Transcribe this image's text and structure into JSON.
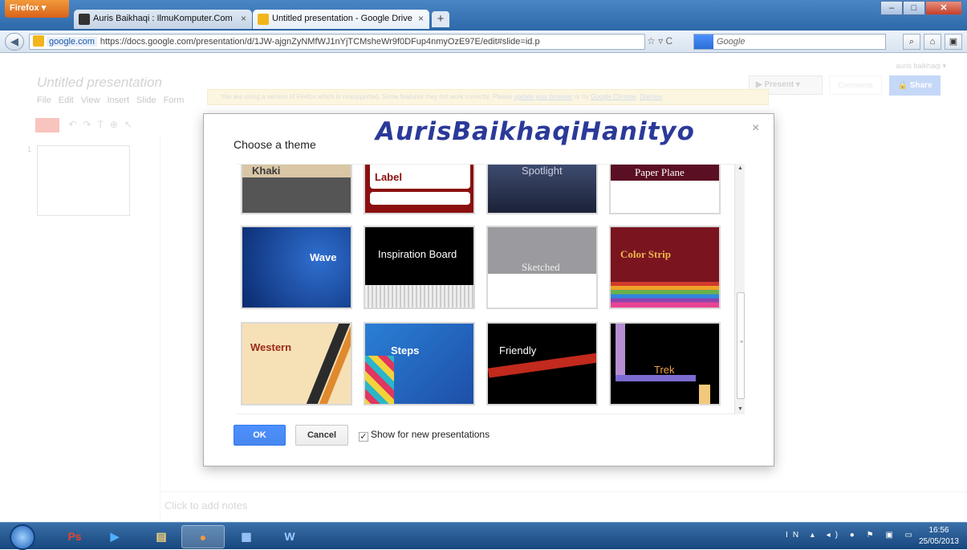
{
  "browser": {
    "menu_button": "Firefox",
    "tabs": [
      {
        "label": "Auris Baikhaqi : IlmuKomputer.Com",
        "close": "×"
      },
      {
        "label": "Untitled presentation - Google Drive",
        "close": "×"
      }
    ],
    "new_tab": "+",
    "url_domain": "google.com",
    "url": "https://docs.google.com/presentation/d/1JW-ajgnZyNMfWJ1nYjTCMsheWr9f0DFup4nmyOzE97E/edit#slide=id.p",
    "search_placeholder": "Google"
  },
  "slides": {
    "doc_title": "Untitled presentation",
    "menu": "File Edit View Insert Slide Form",
    "user": "auris baikhaqi ▾",
    "present_label": "Present",
    "comments_label": "Comments",
    "share_label": "Share",
    "warning_text": "You are using a version of Firefox which is unsupported. Some features may not work correctly. Please",
    "warning_link_update": "update your browser",
    "warning_or": "or try",
    "warning_link_chrome": "Google Chrome",
    "warning_dismiss": "Dismiss",
    "slide_number": "1",
    "notes_placeholder": "Click to add notes"
  },
  "dialog": {
    "title": "Choose a theme",
    "watermark": "AurisBaikhaqiHanityo",
    "close": "×",
    "themes": [
      {
        "name": "Khaki"
      },
      {
        "name": "Label"
      },
      {
        "name": "Spotlight"
      },
      {
        "name": "Paper Plane"
      },
      {
        "name": "Wave"
      },
      {
        "name": "Inspiration Board"
      },
      {
        "name": "Sketched"
      },
      {
        "name": "Color Strip"
      },
      {
        "name": "Western"
      },
      {
        "name": "Steps"
      },
      {
        "name": "Friendly"
      },
      {
        "name": "Trek"
      }
    ],
    "ok_label": "OK",
    "cancel_label": "Cancel",
    "show_label": "Show for new presentations",
    "show_checked": true
  },
  "taskbar": {
    "language": "IN",
    "time": "16:56",
    "date": "25/05/2013"
  }
}
